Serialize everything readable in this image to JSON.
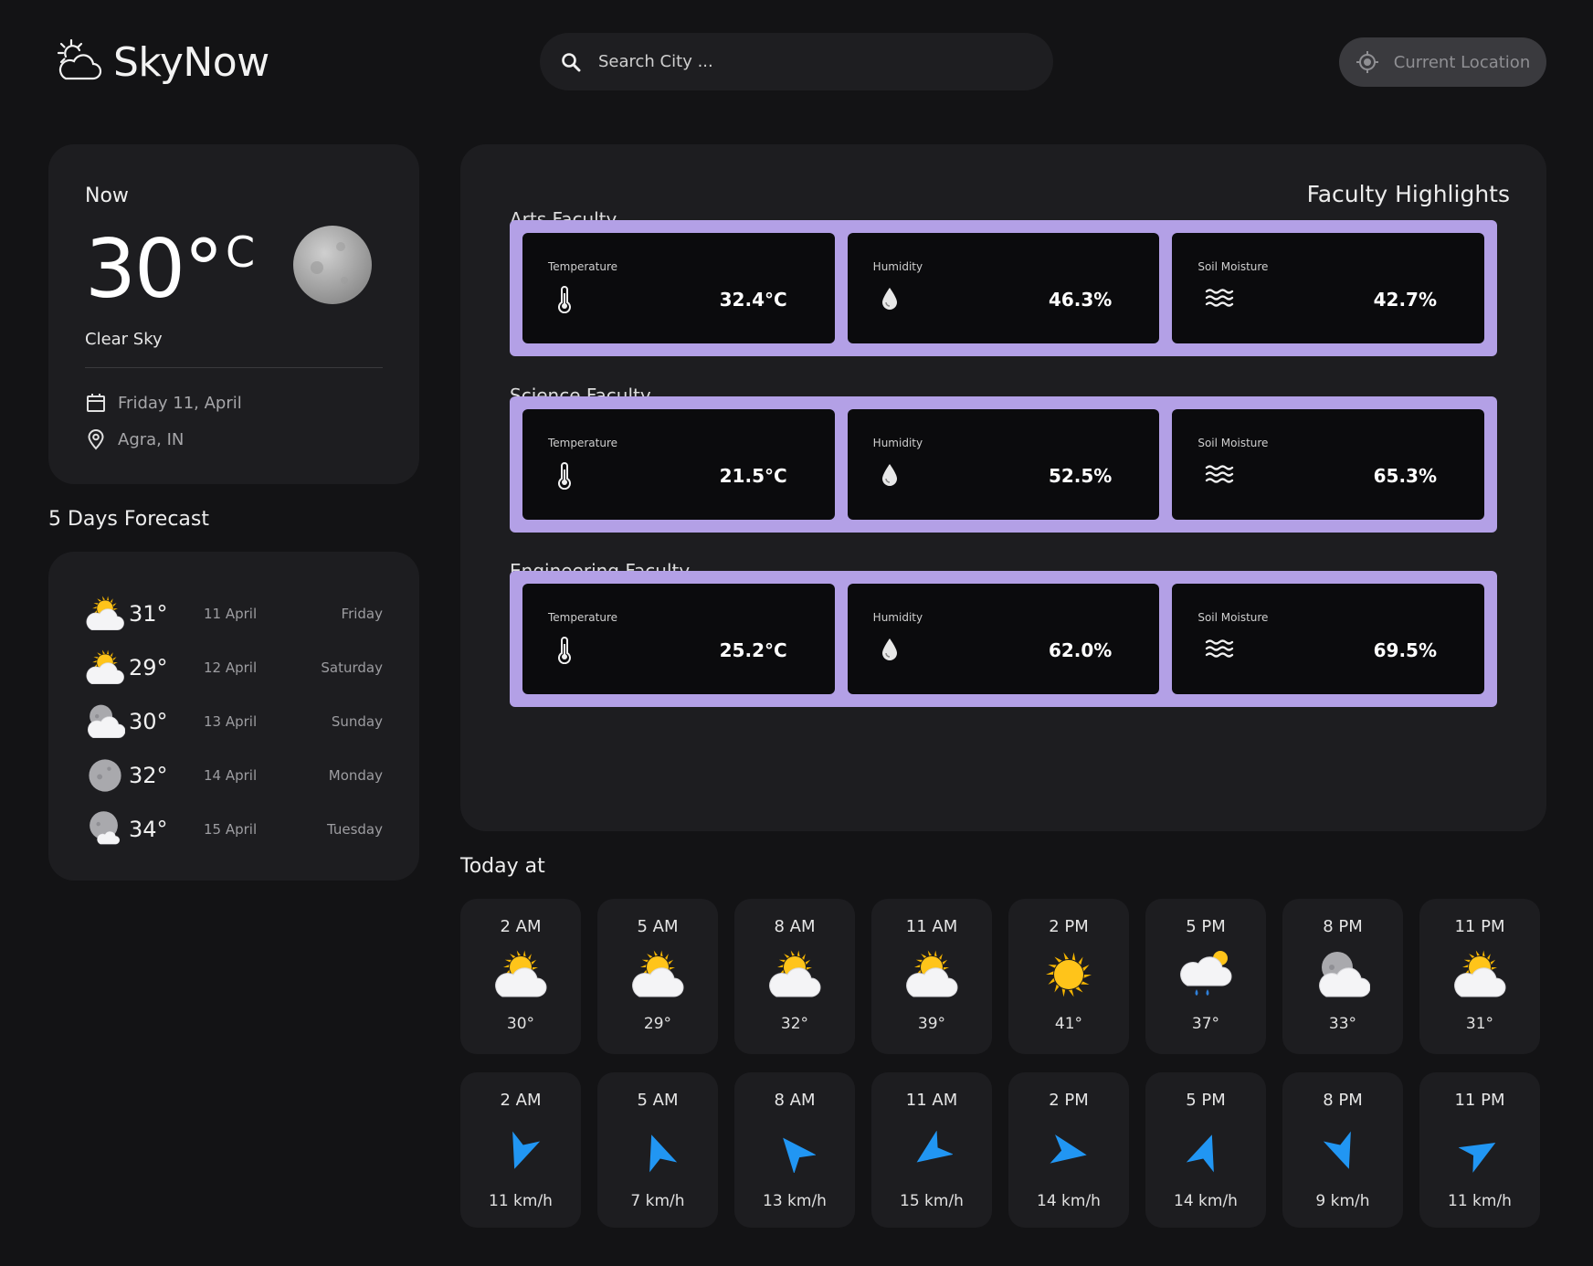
{
  "header": {
    "app_name": "SkyNow",
    "search_placeholder": "Search City ...",
    "location_button": "Current Location"
  },
  "now": {
    "label": "Now",
    "temp": "30°",
    "unit": "C",
    "condition": "Clear Sky",
    "date": "Friday 11, April",
    "location": "Agra, IN"
  },
  "forecast": {
    "title": "5 Days Forecast",
    "days": [
      {
        "icon": "sun-cloud-icon",
        "temp": "31°",
        "date": "11 April",
        "day": "Friday"
      },
      {
        "icon": "sun-cloud-icon",
        "temp": "29°",
        "date": "12 April",
        "day": "Saturday"
      },
      {
        "icon": "moon-cloud-icon",
        "temp": "30°",
        "date": "13 April",
        "day": "Sunday"
      },
      {
        "icon": "moon-icon",
        "temp": "32°",
        "date": "14 April",
        "day": "Monday"
      },
      {
        "icon": "moon-cloud-small-icon",
        "temp": "34°",
        "date": "15 April",
        "day": "Tuesday"
      }
    ]
  },
  "highlights": {
    "title": "Faculty Highlights",
    "metric_labels": {
      "temperature": "Temperature",
      "humidity": "Humidity",
      "soil": "Soil Moisture"
    },
    "faculties": [
      {
        "name": "Arts Faculty",
        "temperature": "32.4°C",
        "humidity": "46.3%",
        "soil": "42.7%"
      },
      {
        "name": "Science Faculty",
        "temperature": "21.5°C",
        "humidity": "52.5%",
        "soil": "65.3%"
      },
      {
        "name": "Engineering Faculty",
        "temperature": "25.2°C",
        "humidity": "62.0%",
        "soil": "69.5%"
      }
    ]
  },
  "today": {
    "title": "Today at",
    "hours": [
      {
        "time": "2 AM",
        "icon": "sun-cloud-icon",
        "temp": "30°"
      },
      {
        "time": "5 AM",
        "icon": "sun-cloud-icon",
        "temp": "29°"
      },
      {
        "time": "8 AM",
        "icon": "sun-cloud-icon",
        "temp": "32°"
      },
      {
        "time": "11 AM",
        "icon": "sun-cloud-icon",
        "temp": "39°"
      },
      {
        "time": "2 PM",
        "icon": "sun-icon",
        "temp": "41°"
      },
      {
        "time": "5 PM",
        "icon": "rain-cloud-icon",
        "temp": "37°"
      },
      {
        "time": "8 PM",
        "icon": "moon-cloud-icon",
        "temp": "33°"
      },
      {
        "time": "11 PM",
        "icon": "sun-cloud-icon",
        "temp": "31°"
      }
    ],
    "wind": [
      {
        "time": "2 AM",
        "speed": "11 km/h",
        "direction_deg": 200
      },
      {
        "time": "5 AM",
        "speed": "7 km/h",
        "direction_deg": 340
      },
      {
        "time": "8 AM",
        "speed": "13 km/h",
        "direction_deg": 320
      },
      {
        "time": "11 AM",
        "speed": "15 km/h",
        "direction_deg": 235
      },
      {
        "time": "2 PM",
        "speed": "14 km/h",
        "direction_deg": 100
      },
      {
        "time": "5 PM",
        "speed": "14 km/h",
        "direction_deg": 20
      },
      {
        "time": "8 PM",
        "speed": "9 km/h",
        "direction_deg": 160
      },
      {
        "time": "11 PM",
        "speed": "11 km/h",
        "direction_deg": 60
      }
    ]
  },
  "colors": {
    "background": "#131315",
    "card": "#1d1d20",
    "faculty_border": "#b3a0e6",
    "wind_arrow": "#2196f3"
  }
}
